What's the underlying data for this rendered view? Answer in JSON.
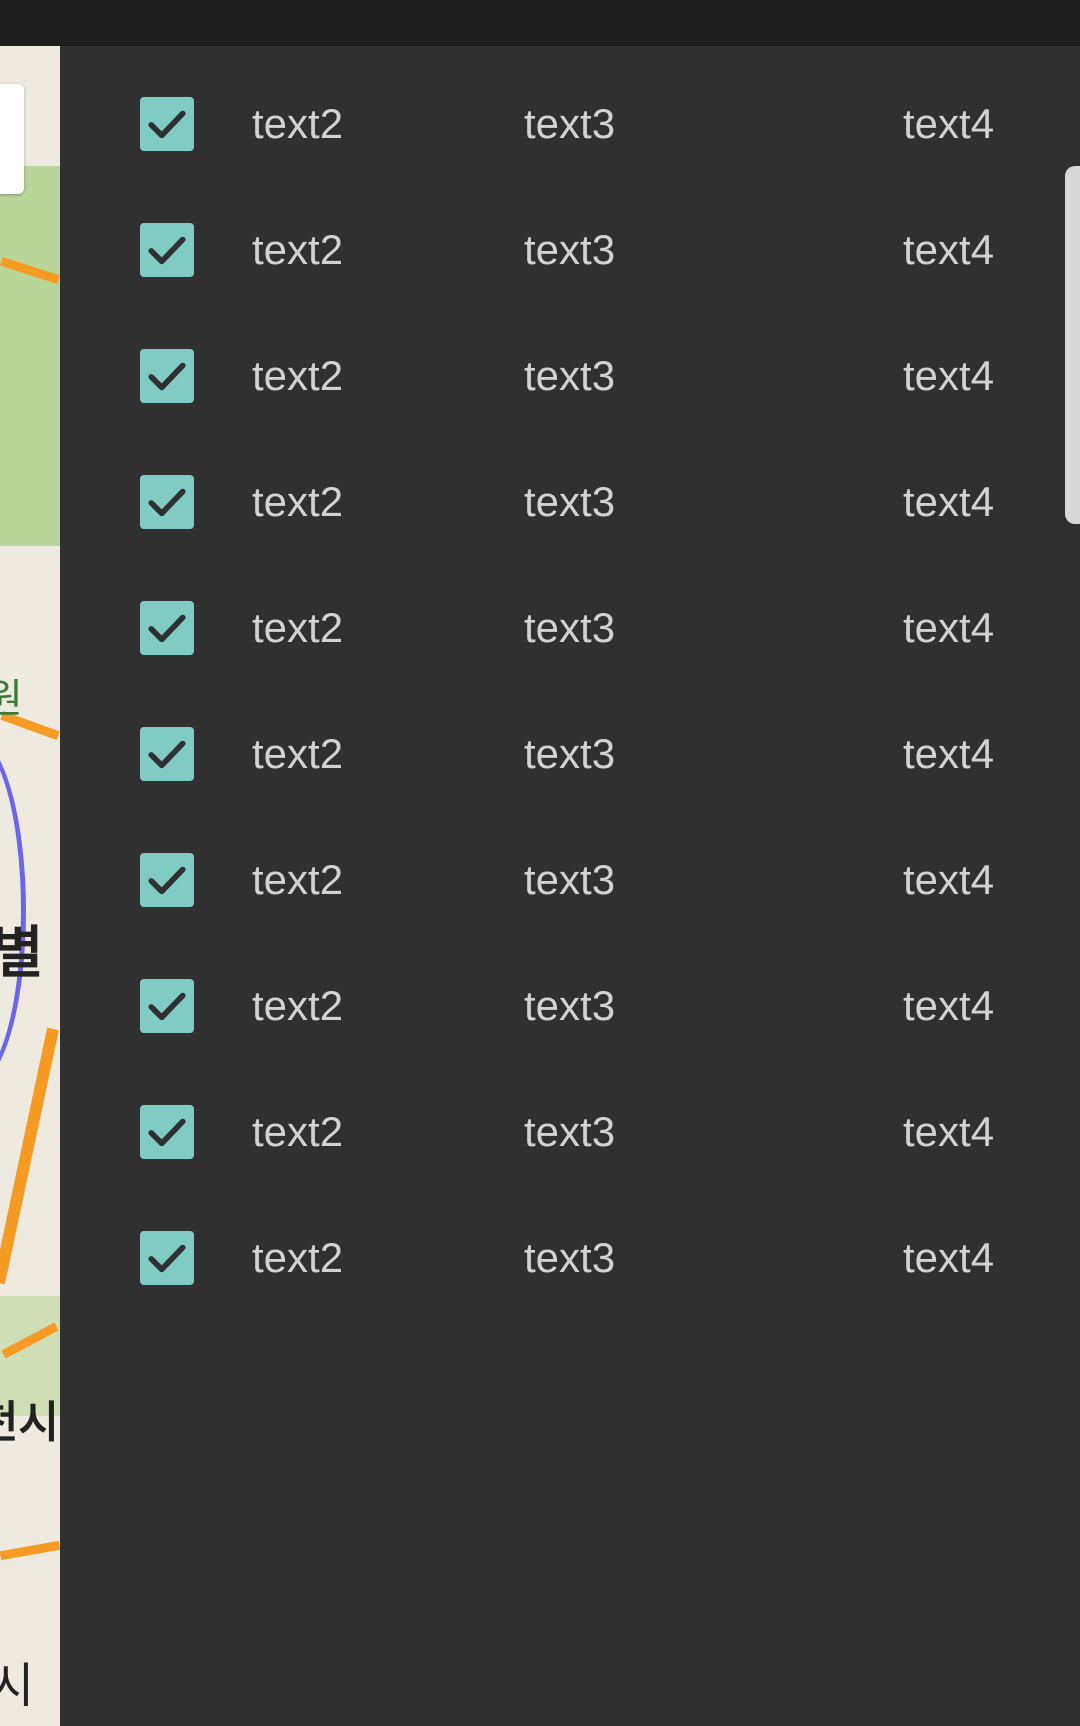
{
  "colors": {
    "background": "#303030",
    "status_bar": "#1e1e1e",
    "checkbox": "#80cbc4",
    "checkmark": "#303030",
    "text": "#d2d2d2"
  },
  "map": {
    "labels": [
      "원",
      "별",
      "천시",
      "시"
    ]
  },
  "list": {
    "rows": [
      {
        "checked": true,
        "col2": "text2",
        "col3": "text3",
        "col4": "text4"
      },
      {
        "checked": true,
        "col2": "text2",
        "col3": "text3",
        "col4": "text4"
      },
      {
        "checked": true,
        "col2": "text2",
        "col3": "text3",
        "col4": "text4"
      },
      {
        "checked": true,
        "col2": "text2",
        "col3": "text3",
        "col4": "text4"
      },
      {
        "checked": true,
        "col2": "text2",
        "col3": "text3",
        "col4": "text4"
      },
      {
        "checked": true,
        "col2": "text2",
        "col3": "text3",
        "col4": "text4"
      },
      {
        "checked": true,
        "col2": "text2",
        "col3": "text3",
        "col4": "text4"
      },
      {
        "checked": true,
        "col2": "text2",
        "col3": "text3",
        "col4": "text4"
      },
      {
        "checked": true,
        "col2": "text2",
        "col3": "text3",
        "col4": "text4"
      },
      {
        "checked": true,
        "col2": "text2",
        "col3": "text3",
        "col4": "text4"
      }
    ]
  }
}
